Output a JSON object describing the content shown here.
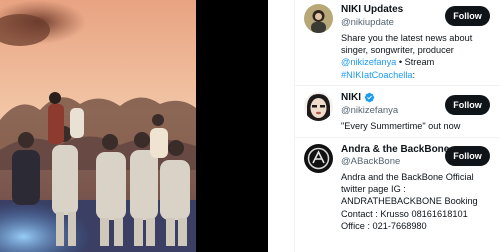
{
  "media": {
    "description_icon": "video-frame-icon"
  },
  "colors": {
    "follow_button_bg": "#0f1419",
    "link": "#1d9bf0",
    "verified": "#1d9bf0",
    "secondary_text": "#536471"
  },
  "who_to_follow": [
    {
      "name": "NIKI Updates",
      "handle": "@nikiupdate",
      "verified": false,
      "follow_label": "Follow",
      "bio_parts": [
        {
          "text": "Share you the latest news about singer, songwriter, producer ",
          "link": false
        },
        {
          "text": "@nikizefanya",
          "link": true
        },
        {
          "text": " • Stream ",
          "link": false
        },
        {
          "text": "#NIKIatCoachella",
          "link": true
        },
        {
          "text": ":",
          "link": false
        }
      ]
    },
    {
      "name": "NIKI",
      "handle": "@nikizefanya",
      "verified": true,
      "follow_label": "Follow",
      "bio_parts": [
        {
          "text": "\"Every Summertime\" out now",
          "link": false
        }
      ]
    },
    {
      "name": "Andra & the BackBone",
      "handle": "@ABackBone",
      "verified": false,
      "follow_label": "Follow",
      "bio_parts": [
        {
          "text": "Andra and the BackBone Official twitter page IG : ANDRATHEBACKBONE Booking Contact : Krusso 08161618101 Office : 021-7668980",
          "link": false
        }
      ]
    }
  ]
}
